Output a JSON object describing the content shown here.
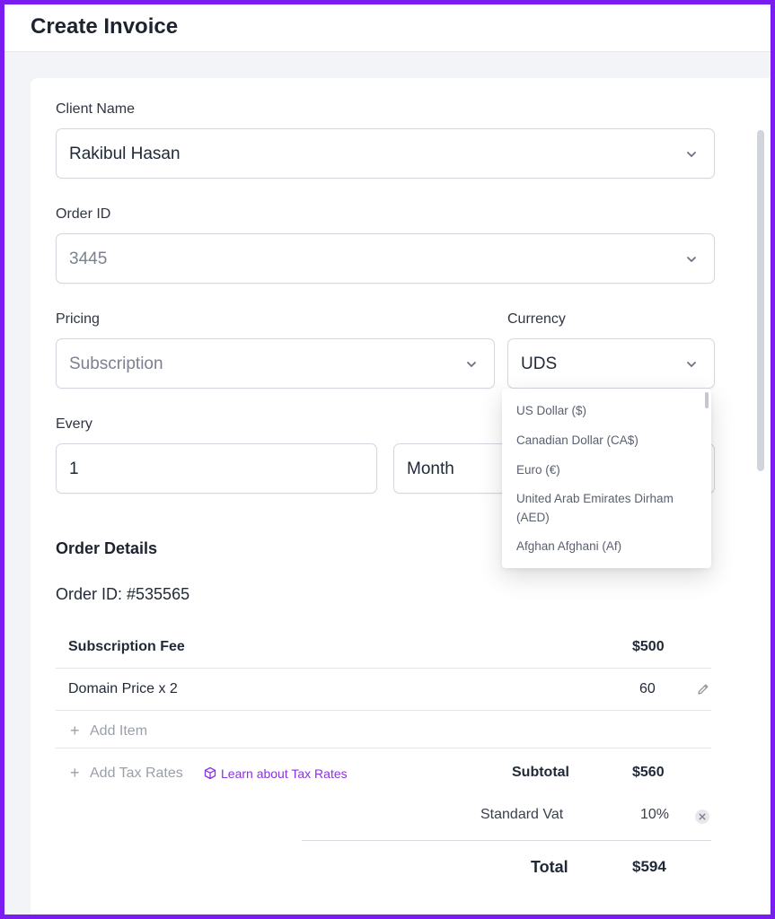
{
  "page": {
    "title": "Create Invoice"
  },
  "form": {
    "client_name": {
      "label": "Client Name",
      "value": "Rakibul Hasan"
    },
    "order_id": {
      "label": "Order ID",
      "value": "3445"
    },
    "pricing": {
      "label": "Pricing",
      "value": "Subscription"
    },
    "currency": {
      "label": "Currency",
      "value": "UDS",
      "options": [
        "US Dollar ($)",
        "Canadian Dollar (CA$)",
        "Euro (€)",
        "United Arab Emirates Dirham (AED)",
        "Afghan Afghani (Af)"
      ]
    },
    "every": {
      "label": "Every",
      "value": "1",
      "unit": "Month"
    }
  },
  "order_details": {
    "title": "Order Details",
    "order_id_line": "Order ID: #535565",
    "items": [
      {
        "name": "Subscription Fee",
        "amount": "$500"
      },
      {
        "name": "Domain Price x 2",
        "amount": "60"
      }
    ],
    "add_item_label": "Add Item",
    "add_tax_label": "Add Tax Rates",
    "learn_tax_label": "Learn about Tax Rates",
    "subtotal": {
      "label": "Subtotal",
      "amount": "$560"
    },
    "tax": {
      "label": "Standard Vat",
      "rate": "10%"
    },
    "total": {
      "label": "Total",
      "amount": "$594"
    }
  },
  "colors": {
    "accent": "#8c2fe6",
    "frame": "#7b1cf0"
  }
}
